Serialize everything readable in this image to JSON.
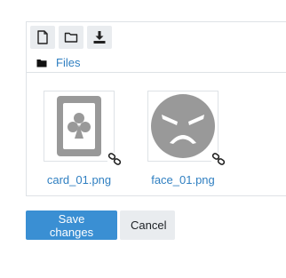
{
  "toolbar": {
    "buttons": [
      {
        "icon": "file-icon"
      },
      {
        "icon": "folder-icon"
      },
      {
        "icon": "download-icon"
      }
    ]
  },
  "path": {
    "icon": "folder-icon",
    "label": "Files"
  },
  "files": [
    {
      "name": "card_01.png",
      "thumb": "card-club-icon",
      "badge": "link-icon"
    },
    {
      "name": "face_01.png",
      "thumb": "angry-face-icon",
      "badge": "link-icon"
    }
  ],
  "actions": {
    "save_label": "Save changes",
    "cancel_label": "Cancel"
  },
  "colors": {
    "link": "#2f7fc1",
    "primary": "#3a8fd3",
    "secondary": "#e9ecef",
    "thumb_gray": "#999999"
  }
}
